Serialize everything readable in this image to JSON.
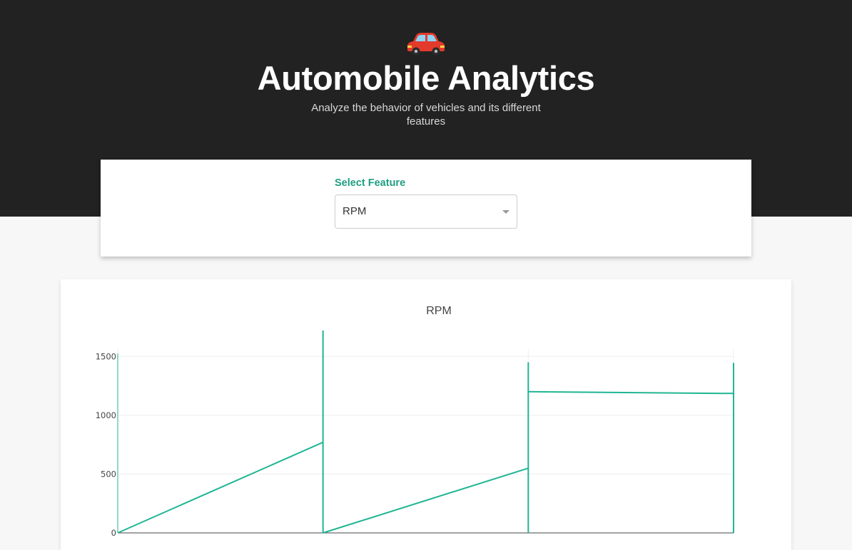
{
  "header": {
    "logo_icon": "car-icon",
    "title": "Automobile Analytics",
    "subtitle": "Analyze the behavior of vehicles and its different features",
    "background_color": "#222222"
  },
  "feature_selector": {
    "label": "Select Feature",
    "selected": "RPM",
    "accent_color": "#1f9d82"
  },
  "chart_data": {
    "type": "line",
    "title": "RPM",
    "xlabel": "",
    "ylabel": "",
    "ylim": [
      0,
      1550
    ],
    "yticks": [
      0,
      500,
      1000,
      1500
    ],
    "xlim": [
      0,
      3
    ],
    "grid": true,
    "line_color": "#1fb594",
    "series": [
      {
        "segments": [
          [
            [
              0,
              0
            ],
            [
              1,
              770
            ]
          ],
          [
            [
              1,
              1720
            ],
            [
              1,
              0
            ]
          ],
          [
            [
              1,
              0
            ],
            [
              2,
              550
            ]
          ],
          [
            [
              2,
              0
            ],
            [
              2,
              1450
            ]
          ],
          [
            [
              2,
              1200
            ],
            [
              3,
              1185
            ]
          ],
          [
            [
              3,
              1445
            ],
            [
              3,
              0
            ]
          ]
        ]
      }
    ]
  }
}
